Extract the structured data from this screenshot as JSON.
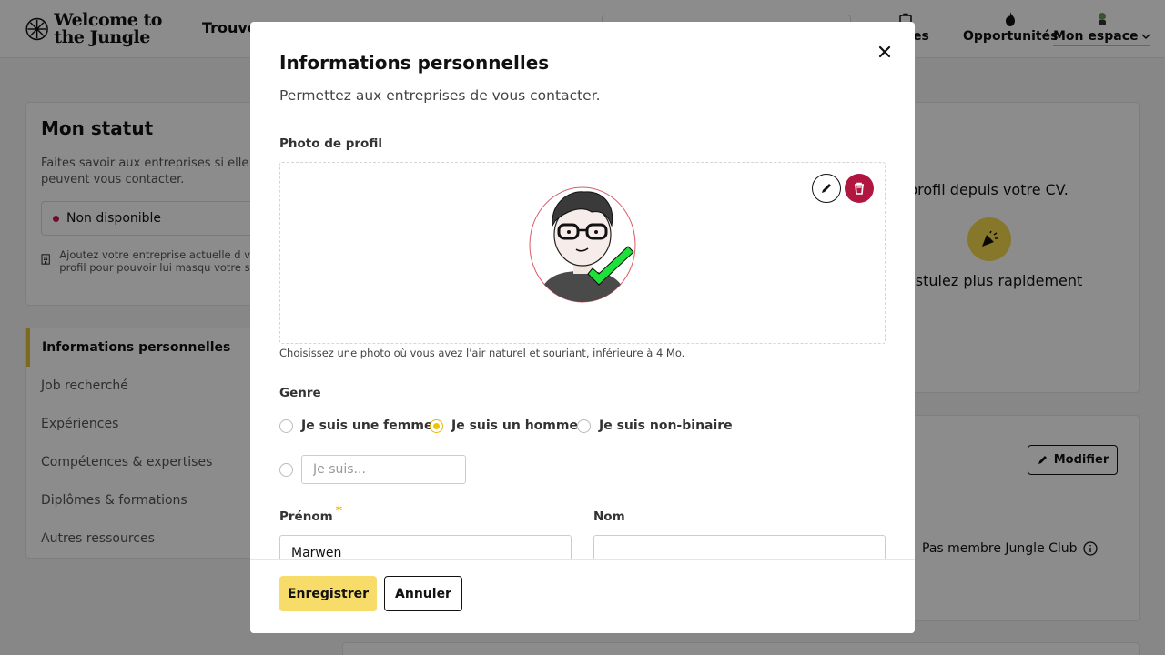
{
  "header": {
    "logo_text": "Welcome to the Jungle",
    "nav_find": "Trouver",
    "nav_candidatures": "atures",
    "nav_opportunites": "Opportunités",
    "nav_mon_espace": "Mon espace"
  },
  "status_card": {
    "title": "Mon statut",
    "description": "Faites savoir aux entreprises si elle peuvent vous contacter.",
    "status_value": "Non disponible",
    "status_color": "#c8174d",
    "company_hint": "Ajoutez votre entreprise actuelle d votre profil pour pouvoir lui masqu votre statut."
  },
  "sidebar": {
    "items": [
      {
        "label": "Informations personnelles",
        "active": true
      },
      {
        "label": "Job recherché"
      },
      {
        "label": "Expériences"
      },
      {
        "label": "Compétences & expertises"
      },
      {
        "label": "Diplômes & formations"
      },
      {
        "label": "Autres ressources"
      }
    ]
  },
  "right_panel": {
    "cv_text": "profil depuis votre CV.",
    "apply_text": "ostulez plus rapidement",
    "modify_label": "Modifier",
    "club_text": "Pas membre Jungle Club"
  },
  "modal": {
    "title": "Informations personnelles",
    "subtitle": "Permettez aux entreprises de vous contacter.",
    "photo_label": "Photo de profil",
    "photo_hint": "Choisissez une photo où vous avez l'air naturel et souriant, inférieure à 4 Mo.",
    "gender_label": "Genre",
    "gender_options": [
      {
        "label": "Je suis une femme",
        "checked": false
      },
      {
        "label": "Je suis un homme",
        "checked": true
      },
      {
        "label": "Je suis non-binaire",
        "checked": false
      }
    ],
    "gender_custom_placeholder": "Je suis...",
    "first_name_label": "Prénom",
    "first_name_required_mark": "*",
    "first_name_value": "Marwen",
    "last_name_label": "Nom",
    "last_name_value": "",
    "save_label": "Enregistrer",
    "cancel_label": "Annuler",
    "accent_color": "#f7dc6a",
    "delete_color": "#b0163f"
  }
}
